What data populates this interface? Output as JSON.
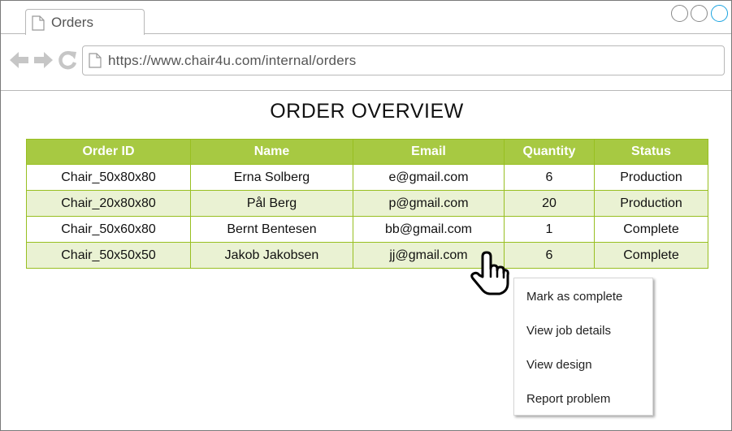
{
  "browser": {
    "tab_title": "Orders",
    "url": "https://www.chair4u.com/internal/orders"
  },
  "page": {
    "title": "ORDER OVERVIEW"
  },
  "table": {
    "headers": [
      "Order ID",
      "Name",
      "Email",
      "Quantity",
      "Status"
    ],
    "rows": [
      [
        "Chair_50x80x80",
        "Erna Solberg",
        "e@gmail.com",
        "6",
        "Production"
      ],
      [
        "Chair_20x80x80",
        "Pål Berg",
        "p@gmail.com",
        "20",
        "Production"
      ],
      [
        "Chair_50x60x80",
        "Bernt Bentesen",
        "bb@gmail.com",
        "1",
        "Complete"
      ],
      [
        "Chair_50x50x50",
        "Jakob Jakobsen",
        "jj@gmail.com",
        "6",
        "Complete"
      ]
    ]
  },
  "context_menu": {
    "items": [
      "Mark as complete",
      "View job details",
      "View design",
      "Report problem"
    ]
  },
  "colors": {
    "header_green": "#a7c942",
    "row_alt": "#eaf2d3",
    "border_green": "#98bf21",
    "active_window_button": "#1aa3e0"
  },
  "icons": {
    "tab": "page-icon",
    "url": "page-icon",
    "back": "back-arrow-icon",
    "forward": "forward-arrow-icon",
    "reload": "reload-icon",
    "cursor": "hand-pointer-icon"
  }
}
